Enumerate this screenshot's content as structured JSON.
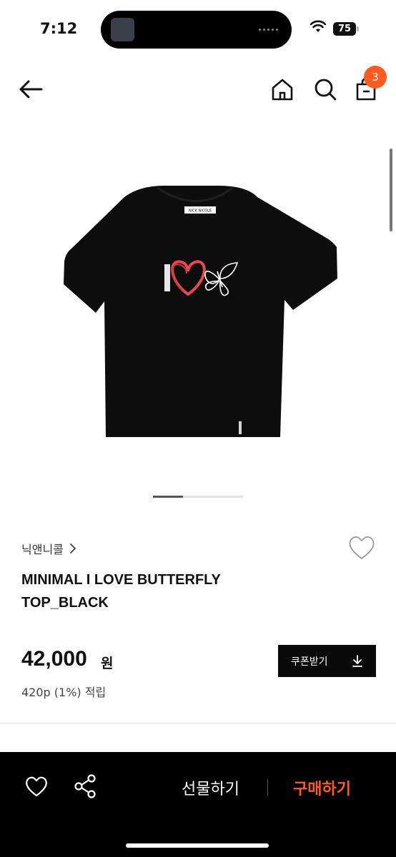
{
  "status_bar": {
    "time": "7:12",
    "battery": "75"
  },
  "header": {
    "cart_count": "3"
  },
  "product": {
    "brand": "닉앤니콜",
    "name_line1": "MINIMAL I LOVE BUTTERFLY",
    "name_line2": "TOP_BLACK",
    "price": "42,000",
    "price_unit": "원",
    "points": "420p (1%) 적립",
    "tag_text": "NICK NICOLE"
  },
  "coupon": {
    "label": "쿠폰받기"
  },
  "pager": {
    "current": 1,
    "total": 3
  },
  "bottom_bar": {
    "gift_label": "선물하기",
    "buy_label": "구매하기"
  },
  "colors": {
    "accent": "#ff5a1f",
    "dark": "#0a0a0a",
    "shirt": "#0d0d0d",
    "heart": "#e5484d"
  }
}
